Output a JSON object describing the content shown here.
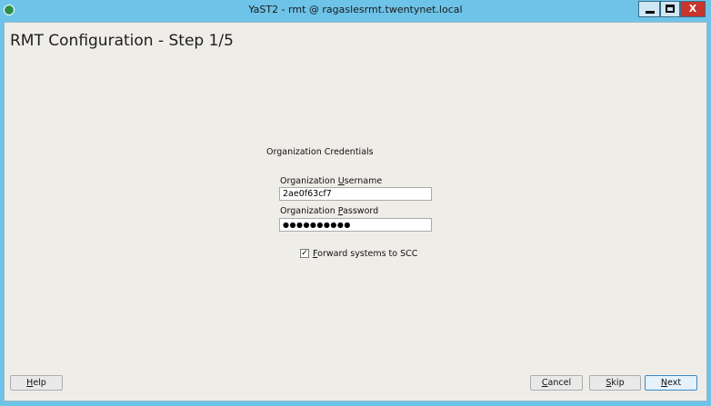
{
  "window": {
    "title": "YaST2 - rmt @ ragaslesrmt.twentynet.local",
    "buttons": {
      "minimize": "_",
      "maximize": "□",
      "close": "X"
    }
  },
  "page": {
    "title": "RMT Configuration - Step 1/5"
  },
  "form": {
    "group_label": "Organization Credentials",
    "username_label_pre": "Organization ",
    "username_label_mnemonic": "U",
    "username_label_post": "sername",
    "username_value": "2ae0f63cf7",
    "password_label_pre": "Organization ",
    "password_label_mnemonic": "P",
    "password_label_post": "assword",
    "password_value": "●●●●●●●●●●",
    "checkbox_checked": true,
    "checkbox_mark": "✓",
    "checkbox_label_mnemonic": "F",
    "checkbox_label_post": "orward systems to SCC"
  },
  "footer": {
    "help_mnemonic": "H",
    "help_post": "elp",
    "cancel_mnemonic": "C",
    "cancel_post": "ancel",
    "skip_mnemonic": "S",
    "skip_post": "kip",
    "next_mnemonic": "N",
    "next_post": "ext"
  }
}
